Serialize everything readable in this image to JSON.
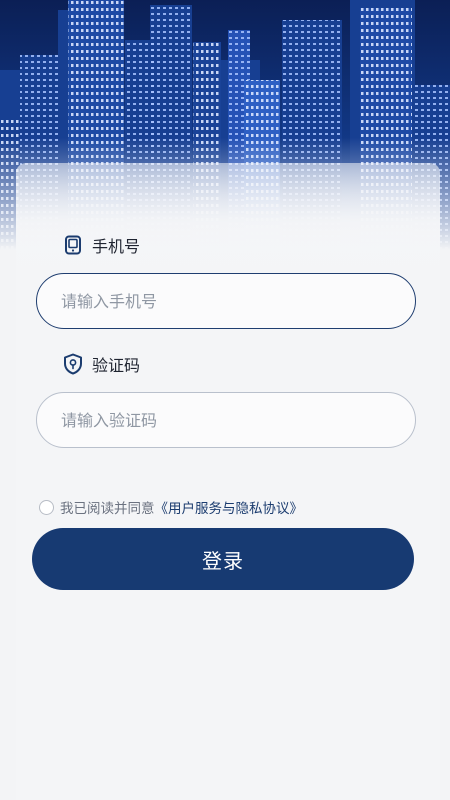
{
  "login": {
    "phone_label": "手机号",
    "phone_placeholder": "请输入手机号",
    "phone_value": "",
    "code_label": "验证码",
    "code_placeholder": "请输入验证码",
    "code_value": "",
    "agree_text": "我已阅读并同意",
    "agree_link": "《用户服务与隐私协议》",
    "agree_checked": false,
    "submit_label": "登录"
  },
  "icons": {
    "phone": "phone-icon",
    "code": "shield-icon"
  },
  "colors": {
    "primary": "#173a72",
    "input_border_active": "#1f3e70",
    "input_border": "#b9c0cc",
    "background": "#f3f4f6"
  }
}
